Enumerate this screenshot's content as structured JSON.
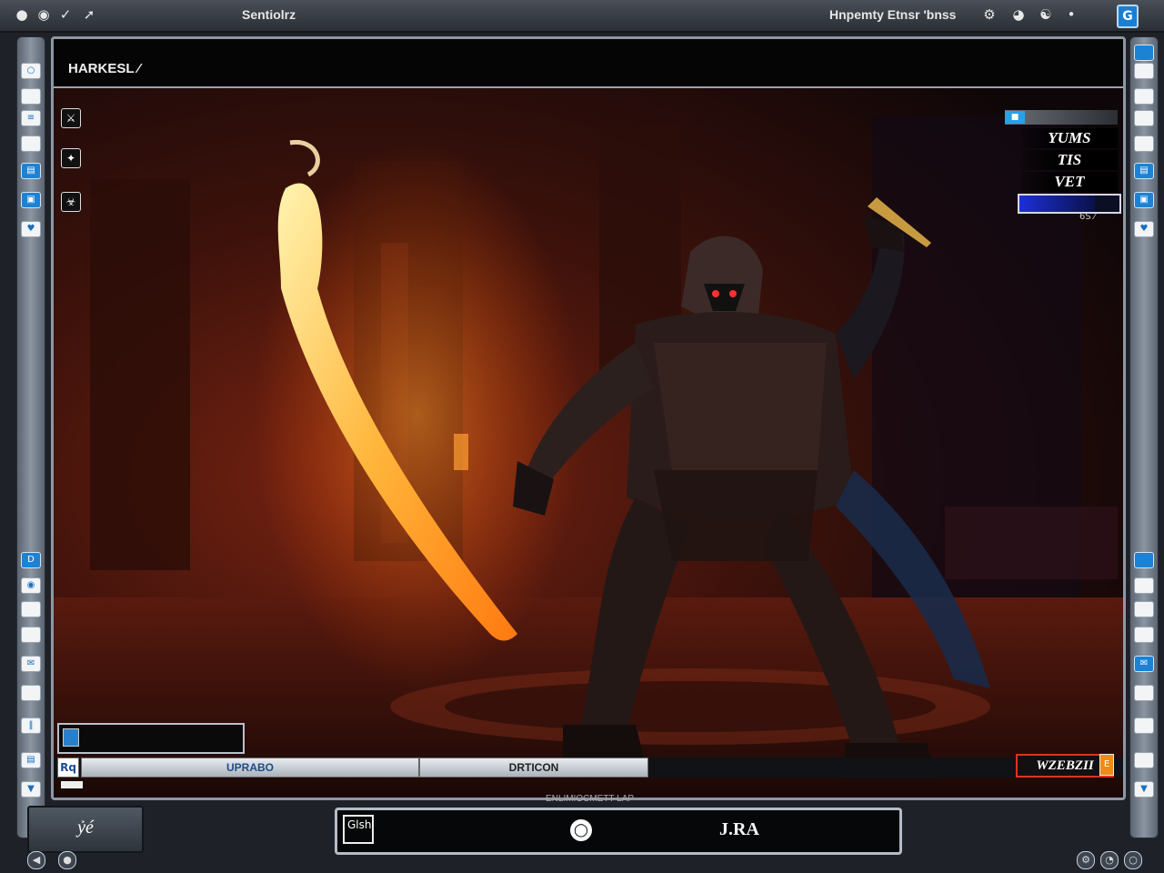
{
  "topbar": {
    "title": "Sentiolrz",
    "status": "Hnpemty Etnsr 'bnss",
    "icons": [
      "settings-icon",
      "close-icon",
      "cursor-icon",
      "letter-g-icon"
    ]
  },
  "viewport": {
    "title": "HARKESL ⁄"
  },
  "stats": {
    "rows": [
      "YUMS",
      "TIS",
      "VET"
    ],
    "bar_value": 0.75,
    "tag": "6S ⁄"
  },
  "bottom_strip": {
    "small": "Rq",
    "left_btn": "UPRABO",
    "center_btn": "DRTICON",
    "score": "WZEBZII",
    "score_tab": "E"
  },
  "dock": {
    "mini_label": "ENLIMIOCMETT LAP",
    "left_label": "ỷé",
    "center_icon_label": "Glsh",
    "center_label": "J.RA"
  },
  "colors": {
    "accent": "#1c82d4",
    "score_border": "#dd3322",
    "stat_bar": "#1d2fd8"
  }
}
